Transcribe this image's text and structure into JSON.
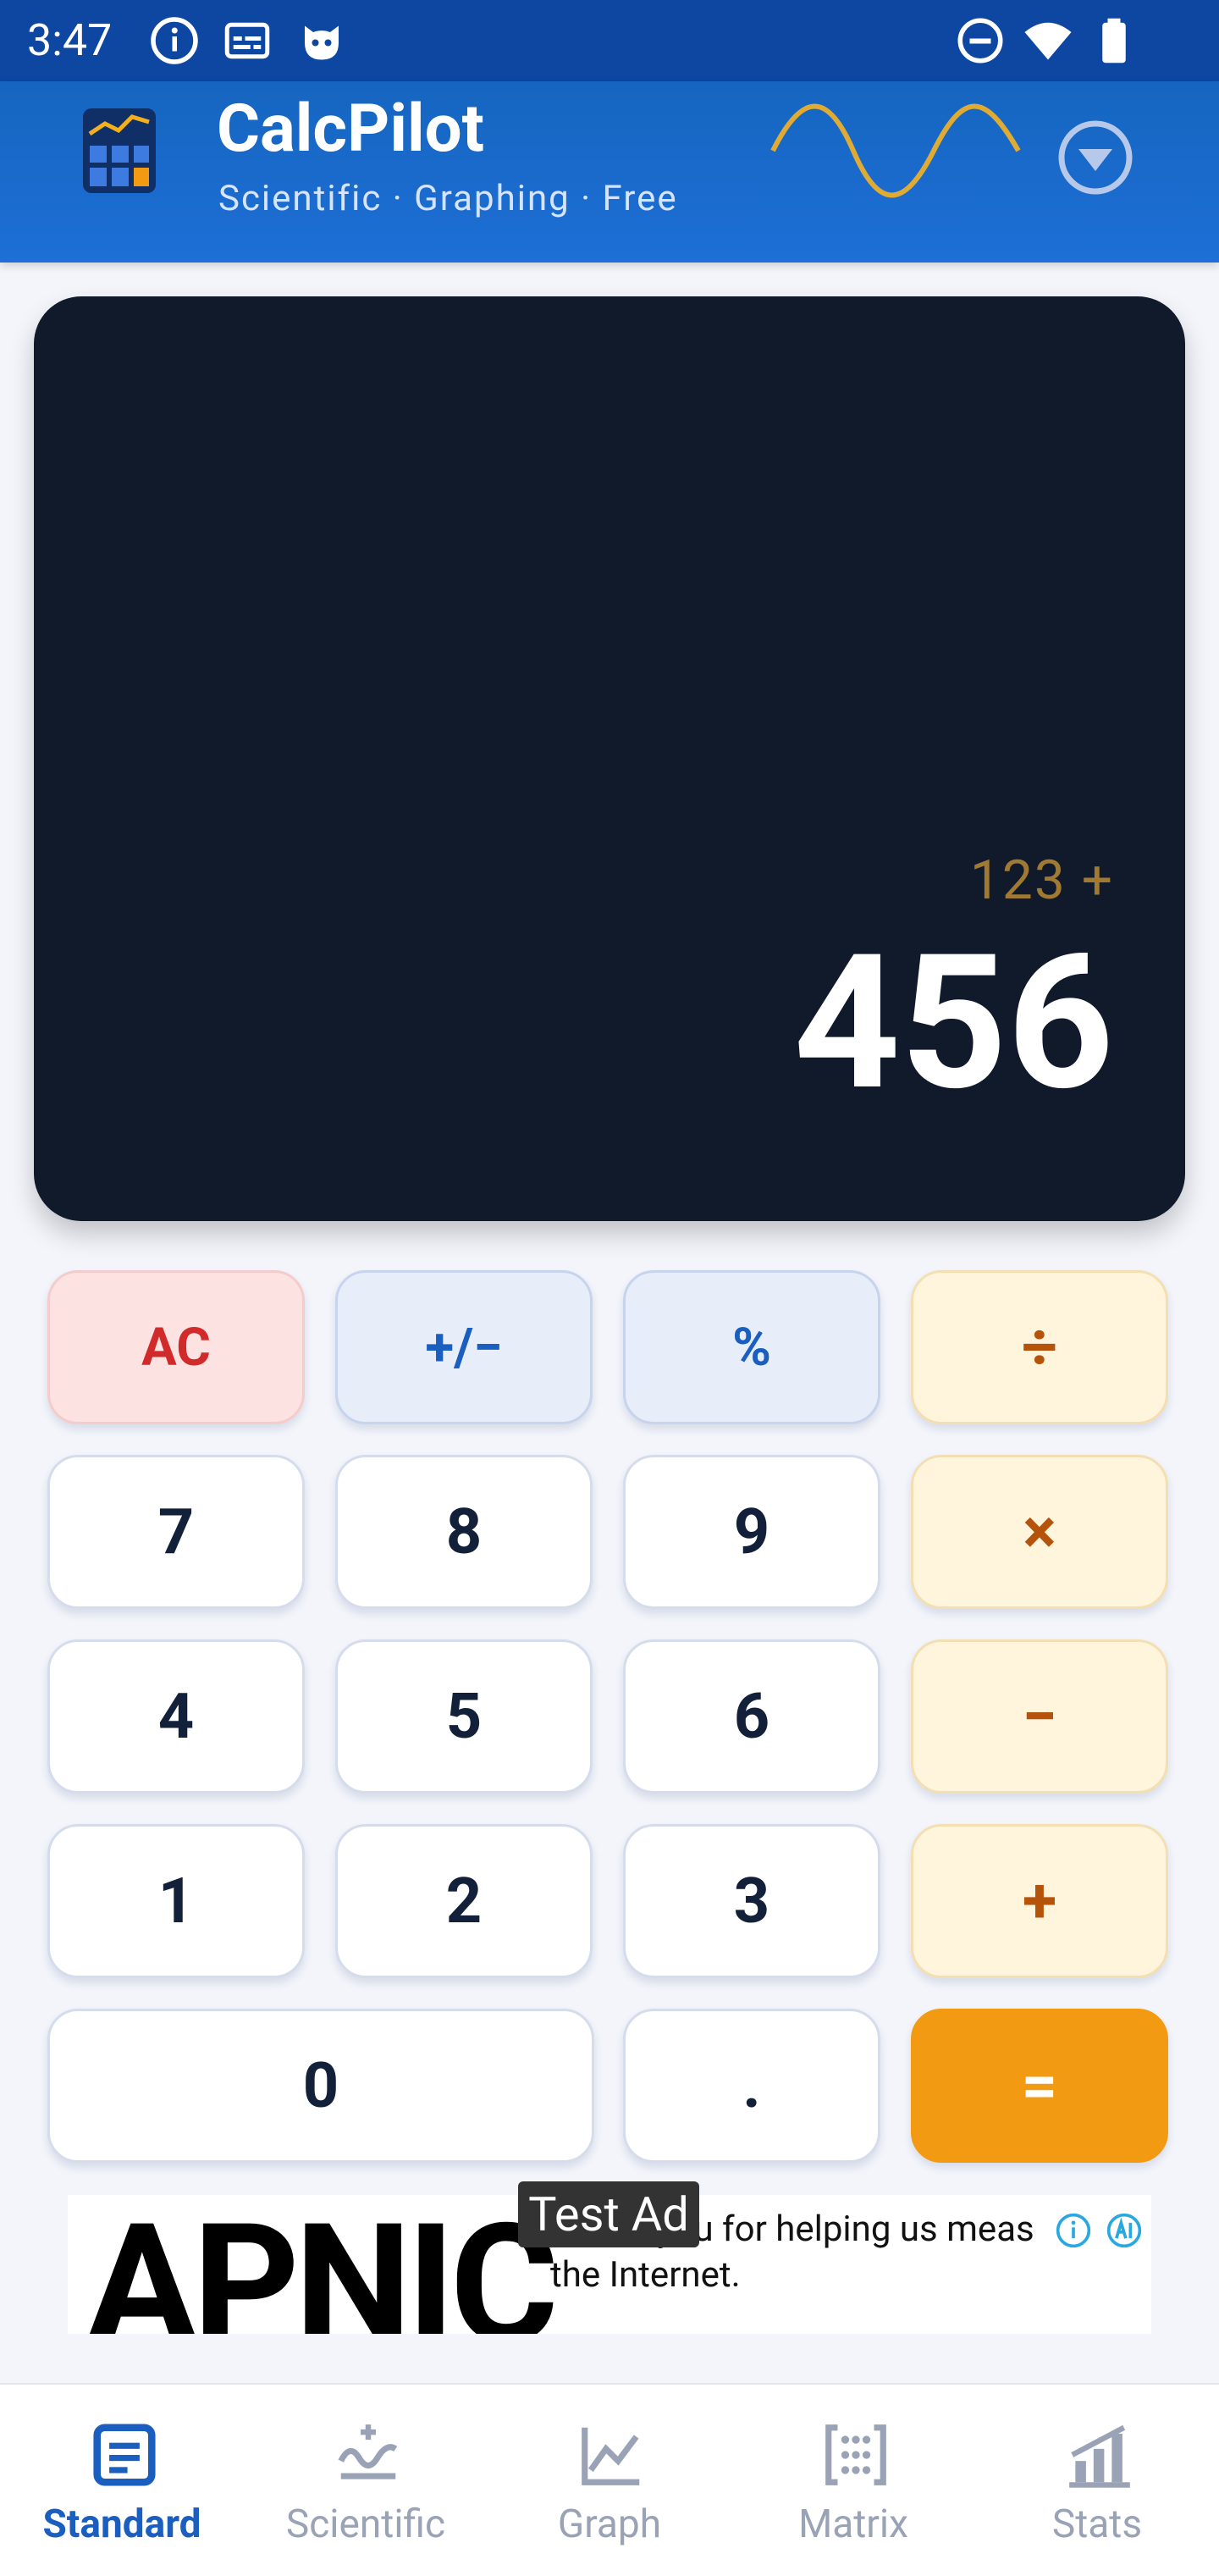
{
  "status_bar": {
    "time": "3:47",
    "left_icons": [
      "info-icon",
      "subtitles-icon",
      "cat-face-icon"
    ],
    "right_icons": [
      "do-not-disturb-icon",
      "wifi-icon",
      "battery-icon"
    ]
  },
  "header": {
    "title": "CalcPilot",
    "subtitle": "Scientific · Graphing · Free",
    "logo_icon": "calculator-chart-logo",
    "wave_icon": "sine-wave-icon",
    "menu_icon": "chevron-down-circle-icon"
  },
  "display": {
    "expression": "123  +",
    "result": "456"
  },
  "keypad": {
    "rows": [
      [
        {
          "label": "AC",
          "kind": "ac"
        },
        {
          "label": "+/−",
          "kind": "fn"
        },
        {
          "label": "%",
          "kind": "fn"
        },
        {
          "label": "÷",
          "kind": "op"
        }
      ],
      [
        {
          "label": "7",
          "kind": "num"
        },
        {
          "label": "8",
          "kind": "num"
        },
        {
          "label": "9",
          "kind": "num"
        },
        {
          "label": "×",
          "kind": "op"
        }
      ],
      [
        {
          "label": "4",
          "kind": "num"
        },
        {
          "label": "5",
          "kind": "num"
        },
        {
          "label": "6",
          "kind": "num"
        },
        {
          "label": "−",
          "kind": "op"
        }
      ],
      [
        {
          "label": "1",
          "kind": "num"
        },
        {
          "label": "2",
          "kind": "num"
        },
        {
          "label": "3",
          "kind": "num"
        },
        {
          "label": "+",
          "kind": "op"
        }
      ],
      [
        {
          "label": "0",
          "kind": "num"
        },
        {
          "label": ".",
          "kind": "num"
        },
        {
          "label": "=",
          "kind": "eq"
        }
      ]
    ]
  },
  "ad": {
    "badge": "Test Ad",
    "brand": "APNIC",
    "text_line1": "Thank you for helping us meas",
    "text_line2": "the Internet."
  },
  "bottom_nav": {
    "items": [
      {
        "label": "Standard",
        "icon": "document-lines-icon",
        "active": true
      },
      {
        "label": "Scientific",
        "icon": "function-curve-icon",
        "active": false
      },
      {
        "label": "Graph",
        "icon": "line-chart-icon",
        "active": false
      },
      {
        "label": "Matrix",
        "icon": "matrix-brackets-icon",
        "active": false
      },
      {
        "label": "Stats",
        "icon": "bar-chart-icon",
        "active": false
      }
    ]
  },
  "colors": {
    "primary": "#1565c0",
    "status_bar": "#0d47a1",
    "display_bg": "#101a2b",
    "accent_orange": "#f29b12",
    "ac_red": "#d12a2a"
  }
}
